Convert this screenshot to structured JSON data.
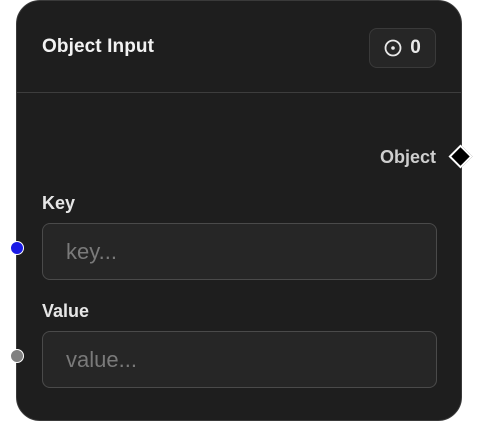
{
  "node": {
    "title": "Object Input",
    "run_count": "0",
    "run_icon": "circle-dot-icon"
  },
  "output": {
    "label": "Object",
    "handle_shape": "diamond",
    "handle_color": "#000000"
  },
  "fields": {
    "key": {
      "label": "Key",
      "value": "",
      "placeholder": "key...",
      "handle_color": "#1a1ae6"
    },
    "value": {
      "label": "Value",
      "value": "",
      "placeholder": "value...",
      "handle_color": "#808080"
    }
  },
  "theme": {
    "background": "#1e1e1e",
    "border": "#3a3a3a",
    "text": "#f2f2f2",
    "placeholder": "#7a7a7a"
  }
}
